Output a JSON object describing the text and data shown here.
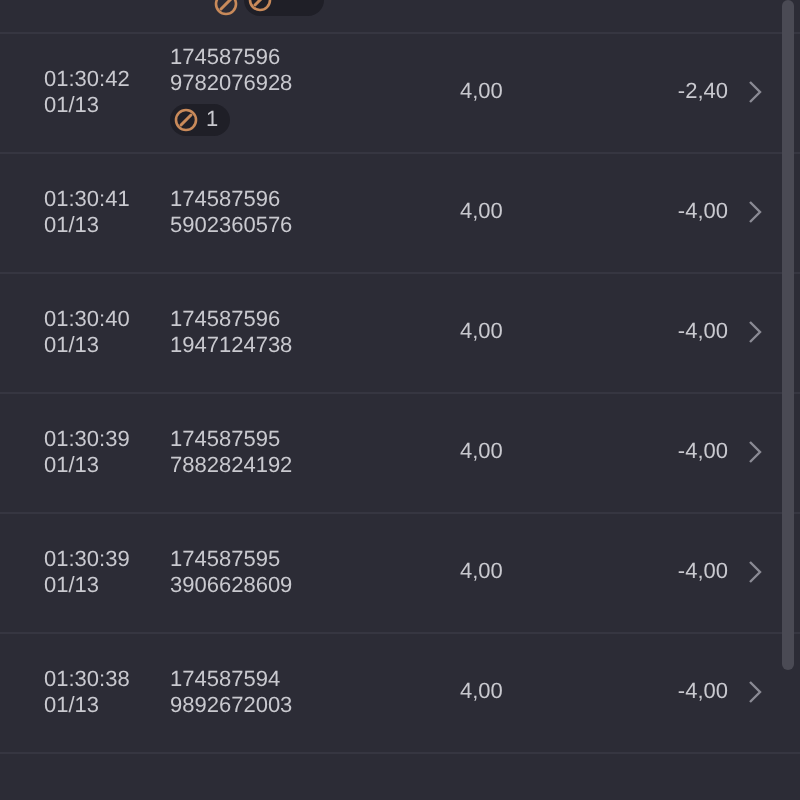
{
  "top_row_badges": [
    {
      "kind": "icon"
    },
    {
      "kind": "count"
    }
  ],
  "rows": [
    {
      "time": "01:30:42",
      "date": "01/13",
      "id_1": "174587596",
      "id_2": "9782076928",
      "amount": "4,00",
      "value": "-2,40",
      "badges": [
        {
          "kind": "count",
          "text": "1"
        }
      ]
    },
    {
      "time": "01:30:41",
      "date": "01/13",
      "id_1": "174587596",
      "id_2": "5902360576",
      "amount": "4,00",
      "value": "-4,00"
    },
    {
      "time": "01:30:40",
      "date": "01/13",
      "id_1": "174587596",
      "id_2": "1947124738",
      "amount": "4,00",
      "value": "-4,00"
    },
    {
      "time": "01:30:39",
      "date": "01/13",
      "id_1": "174587595",
      "id_2": "7882824192",
      "amount": "4,00",
      "value": "-4,00"
    },
    {
      "time": "01:30:39",
      "date": "01/13",
      "id_1": "174587595",
      "id_2": "3906628609",
      "amount": "4,00",
      "value": "-4,00"
    },
    {
      "time": "01:30:38",
      "date": "01/13",
      "id_1": "174587594",
      "id_2": "9892672003",
      "amount": "4,00",
      "value": "-4,00"
    }
  ]
}
